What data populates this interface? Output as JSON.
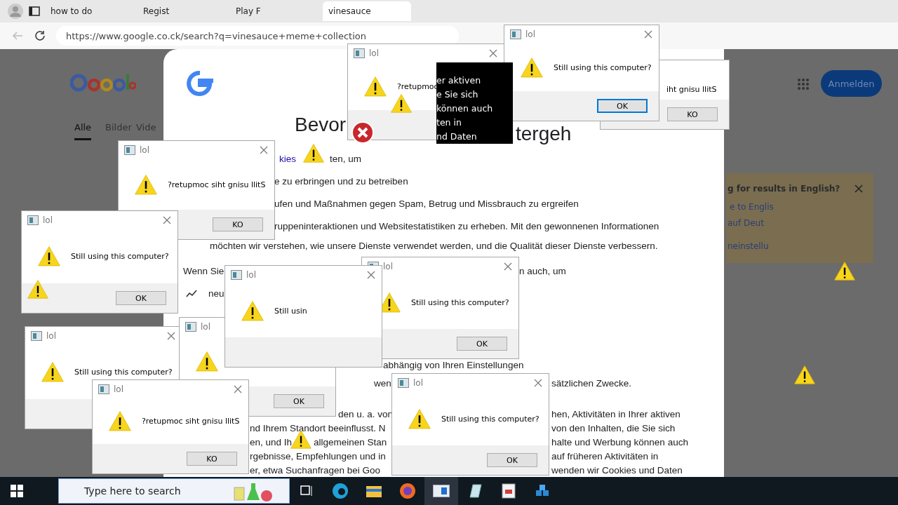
{
  "browser": {
    "tabs": [
      {
        "label": "how to do",
        "selected": false
      },
      {
        "label": "Regist",
        "selected": false
      },
      {
        "label": "Play F",
        "selected": false
      },
      {
        "label": "vinesauce",
        "selected": true
      }
    ],
    "address": "https://www.google.co.ck/search?q=vinesauce+meme+collection"
  },
  "google_page": {
    "nav": [
      {
        "label": "Alle",
        "selected": true
      },
      {
        "label": "Bilder",
        "selected": false
      },
      {
        "label": "Vide",
        "selected": false
      }
    ],
    "sign_in": "Anmelden"
  },
  "consent": {
    "title_parts": [
      "Bevor",
      "tergeh"
    ],
    "fragments": [
      {
        "kind": "link",
        "text": "kies"
      },
      {
        "kind": "text",
        "text": "ten, um"
      },
      {
        "kind": "text",
        "text": "e zu erbringen und zu betreiben"
      },
      {
        "kind": "text",
        "text": "ufen und Maßnahmen gegen Spam, Betrug und Missbrauch zu ergreifen"
      },
      {
        "kind": "text",
        "text": "ruppeninteraktionen und Websitestatistiken zu erheben. Mit den gewonnenen Informationen"
      },
      {
        "kind": "text",
        "text": "möchten wir verstehen, wie unsere Dienste verwendet werden, und die Qualität dieser Dienste verbessern."
      },
      {
        "kind": "text",
        "text": "Wenn Sie"
      },
      {
        "kind": "text",
        "text": "n auch, um"
      },
      {
        "kind": "trend",
        "text": "neu"
      },
      {
        "kind": "text",
        "text": "abhängig von Ihren Einstellungen"
      },
      {
        "kind": "text",
        "text": "wen"
      },
      {
        "kind": "text",
        "text": "sätzlichen Zwecke."
      },
      {
        "kind": "text",
        "text": "den u. a. von"
      },
      {
        "kind": "text",
        "text": "hen, Aktivitäten in Ihrer aktiven"
      },
      {
        "kind": "text",
        "text": "nd Ihrem Standort beeinflusst. N"
      },
      {
        "kind": "text",
        "text": "von den Inhalten, die Sie sich"
      },
      {
        "kind": "text",
        "text": "en, und Ih"
      },
      {
        "kind": "text",
        "text": "allgemeinen Stan"
      },
      {
        "kind": "text",
        "text": "halte und Werbung können auch"
      },
      {
        "kind": "text",
        "text": "rgebnisse, Empfehlungen und in"
      },
      {
        "kind": "text",
        "text": "auf früheren Aktivitäten in"
      },
      {
        "kind": "text",
        "text": "er, etwa Suchanfragen bei Goo"
      },
      {
        "kind": "text",
        "text": "wenden wir Cookies und Daten"
      }
    ]
  },
  "language_prompt": {
    "title": "g for results in English?",
    "link": "e to Englis",
    "option": "auf Deut",
    "settings": "neinstellu"
  },
  "glitch_text": [
    "er aktiven",
    "e Sie sich",
    "können auch",
    "ten in",
    "nd Daten"
  ],
  "dialogs": [
    {
      "message": "iht gnisu llitS",
      "button": "KO",
      "focused": false
    },
    {
      "title": "lol",
      "icon": true,
      "message": "?retupmoc"
    },
    {
      "title": "lol",
      "icon": true,
      "message": "Still using this computer?",
      "button": "OK",
      "focused": true
    },
    {
      "title": "lol",
      "icon": true,
      "message": "?retupmoc siht gnisu llitS",
      "button": "KO",
      "focused": false
    },
    {
      "title": "lol",
      "icon": true,
      "message": "Still using this computer?",
      "button": "OK",
      "focused": false
    },
    {
      "title": "lol",
      "icon": true,
      "message": "Still using this computer?"
    },
    {
      "title": "lol",
      "icon": true,
      "button": "OK",
      "focused": false
    },
    {
      "title": "lol",
      "icon": true,
      "message": "Still using this computer?",
      "button": "OK",
      "focused": false
    },
    {
      "title": "lol",
      "icon": true,
      "message": "Still usin"
    },
    {
      "title": "lol",
      "icon": true,
      "message": "?retupmoc siht gnisu llitS",
      "button": "KO",
      "focused": false
    },
    {
      "title": "lol",
      "icon": true,
      "message": "Still using this computer?",
      "button": "OK",
      "focused": false
    }
  ],
  "taskbar": {
    "search_placeholder": "Type here to search"
  }
}
